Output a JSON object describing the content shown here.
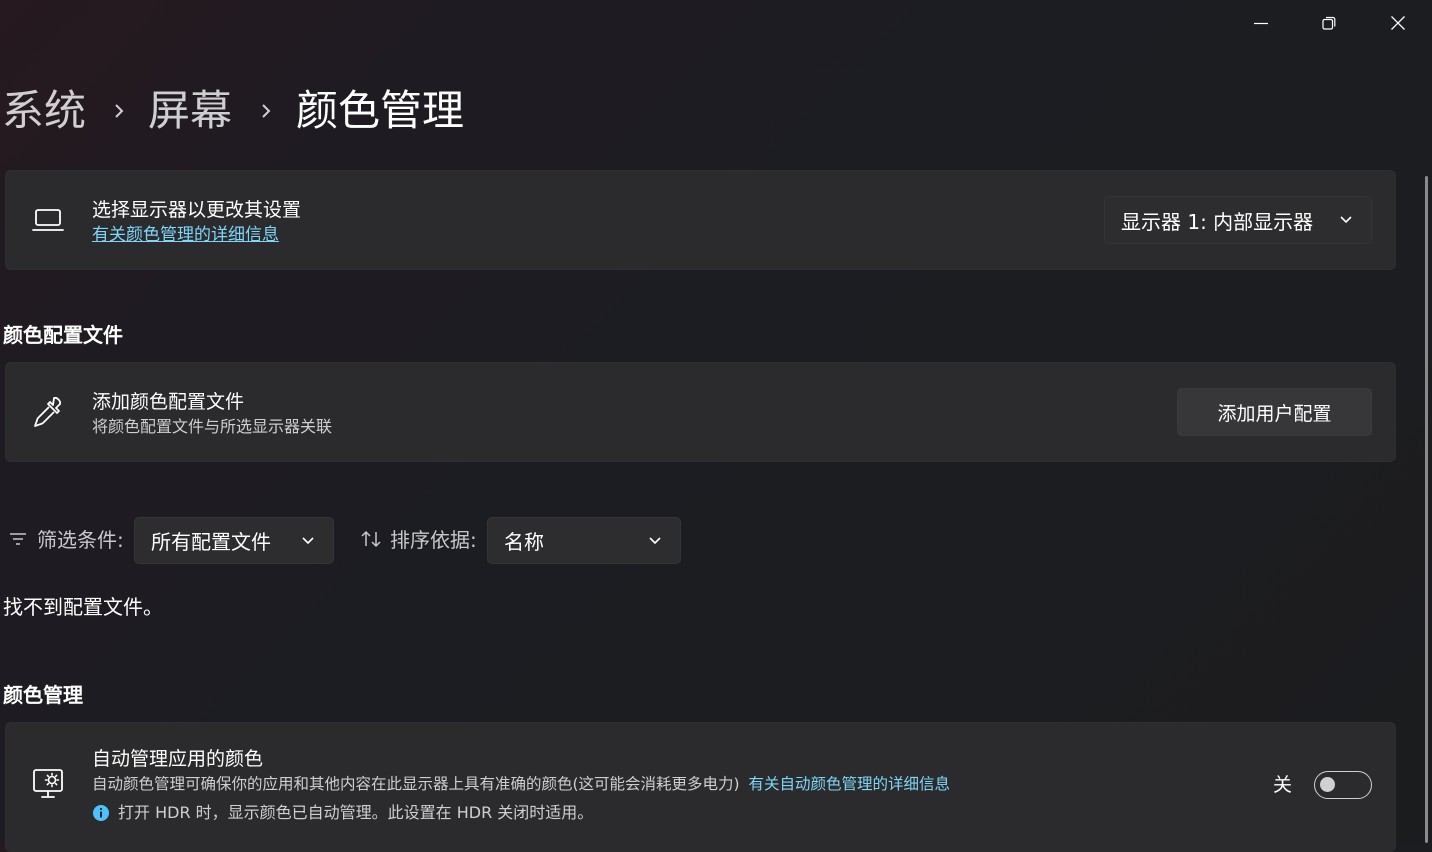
{
  "window": {
    "controls": [
      "minimize",
      "restore",
      "close"
    ]
  },
  "breadcrumb": {
    "items": [
      "系统",
      "屏幕",
      "颜色管理"
    ]
  },
  "display_card": {
    "title": "选择显示器以更改其设置",
    "link": "有关颜色管理的详细信息",
    "dropdown_value": "显示器 1: 内部显示器",
    "icon": "laptop-icon"
  },
  "profiles_section": {
    "title": "颜色配置文件",
    "card": {
      "title": "添加颜色配置文件",
      "subtitle": "将颜色配置文件与所选显示器关联",
      "button": "添加用户配置",
      "icon": "eyedropper-icon"
    },
    "filter": {
      "label": "筛选条件:",
      "value": "所有配置文件",
      "icon": "filter-icon"
    },
    "sort": {
      "label": "排序依据:",
      "value": "名称",
      "icon": "sort-icon"
    },
    "empty_text": "找不到配置文件。"
  },
  "color_management_section": {
    "title": "颜色管理",
    "card": {
      "title": "自动管理应用的颜色",
      "description": "自动颜色管理可确保你的应用和其他内容在此显示器上具有准确的颜色(这可能会消耗更多电力)",
      "link": "有关自动颜色管理的详细信息",
      "info": "打开 HDR 时，显示颜色已自动管理。此设置在 HDR 关闭时适用。",
      "toggle_label": "关",
      "toggle_on": false,
      "icon": "color-settings-icon"
    }
  },
  "colors": {
    "accent_link": "#7fd6f7",
    "info_icon": "#4cc2ff",
    "card_bg": "#2b2b2d"
  }
}
